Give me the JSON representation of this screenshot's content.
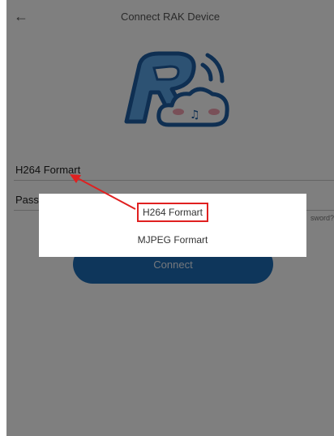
{
  "header": {
    "back_icon": "arrow-left-icon",
    "title": "Connect RAK Device"
  },
  "logo": {
    "icon": "rak-cloud-logo-icon"
  },
  "form": {
    "format_value": "H264 Formart",
    "password_value": "Passw",
    "forgot_link": "sword?",
    "connect_label": "Connect"
  },
  "dialog": {
    "options": [
      {
        "label": "H264 Formart",
        "highlighted": true
      },
      {
        "label": "MJPEG Formart",
        "highlighted": false
      }
    ]
  },
  "annotation": {
    "color": "#e02020"
  },
  "colors": {
    "accent": "#1d6db6",
    "overlay": "rgba(0,0,0,0.5)"
  }
}
